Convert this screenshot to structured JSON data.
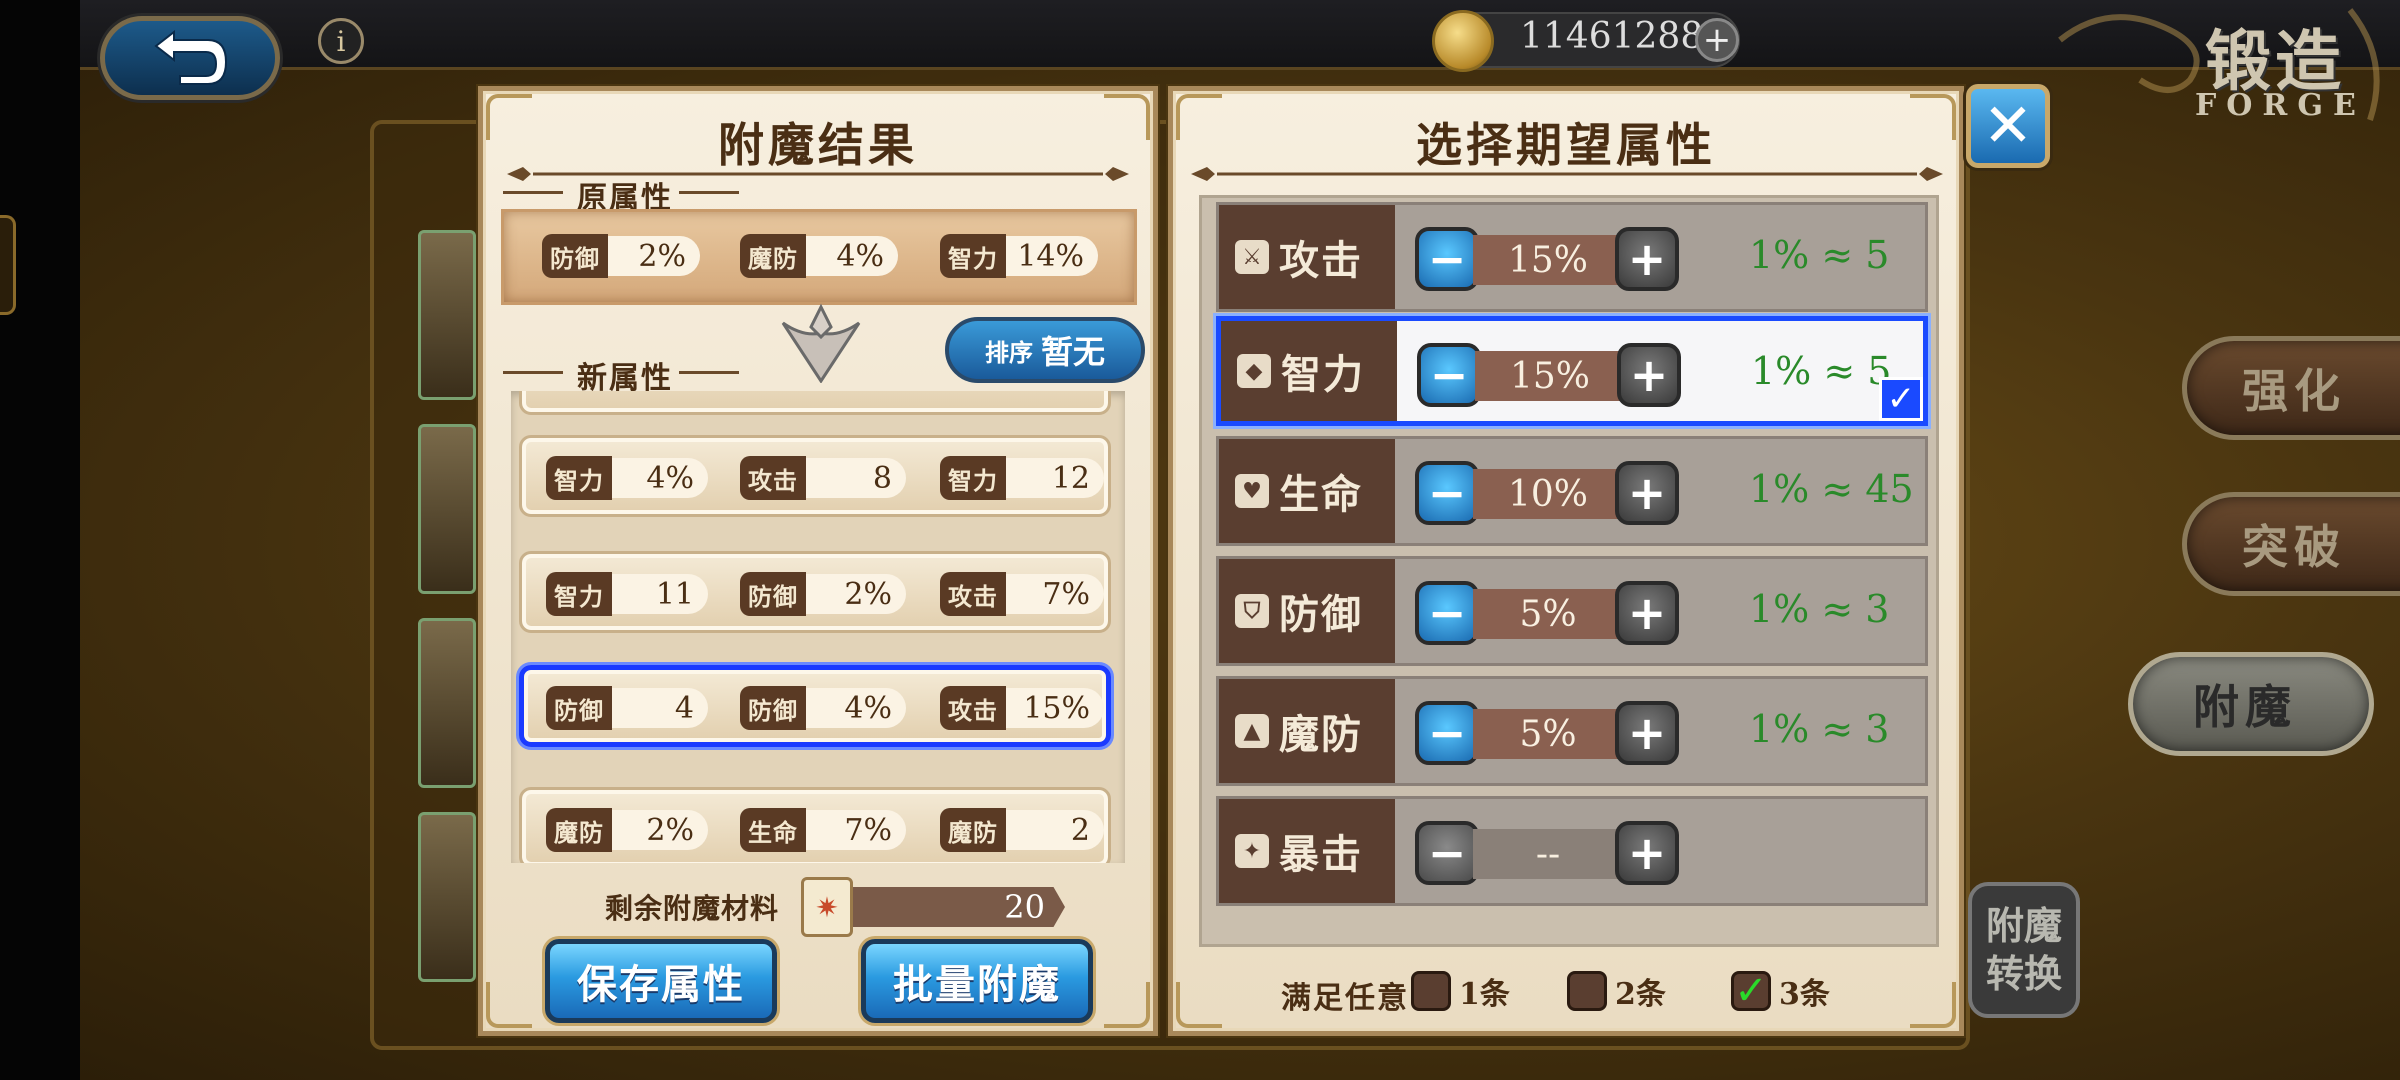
{
  "header": {
    "gold": "11461288",
    "gold_plus": "+",
    "info": "i",
    "forge_title": "锻造",
    "forge_subtitle": "FORGE"
  },
  "side_tabs": {
    "strengthen": "强化",
    "breakthrough": "突破",
    "enchant": "附魔",
    "convert": "附魔转换"
  },
  "left_panel": {
    "title": "附魔结果",
    "original_label": "原属性",
    "original_stats": [
      {
        "name": "防御",
        "value": "2%"
      },
      {
        "name": "魔防",
        "value": "4%"
      },
      {
        "name": "智力",
        "value": "14%"
      }
    ],
    "new_label": "新属性",
    "sort_label": "排序",
    "sort_value": "暂无",
    "results": [
      {
        "stats": [
          {
            "name": "智力",
            "value": "4%"
          },
          {
            "name": "攻击",
            "value": "8"
          },
          {
            "name": "智力",
            "value": "12"
          }
        ]
      },
      {
        "stats": [
          {
            "name": "智力",
            "value": "11"
          },
          {
            "name": "防御",
            "value": "2%"
          },
          {
            "name": "攻击",
            "value": "7%"
          }
        ]
      },
      {
        "stats": [
          {
            "name": "防御",
            "value": "4"
          },
          {
            "name": "防御",
            "value": "4%"
          },
          {
            "name": "攻击",
            "value": "15%"
          }
        ],
        "selected": true
      },
      {
        "stats": [
          {
            "name": "魔防",
            "value": "2%"
          },
          {
            "name": "生命",
            "value": "7%"
          },
          {
            "name": "魔防",
            "value": "2"
          }
        ]
      }
    ],
    "material_label": "剩余附魔材料",
    "material_count": "20",
    "save_button": "保存属性",
    "batch_button": "批量附魔"
  },
  "right_panel": {
    "title": "选择期望属性",
    "attributes": [
      {
        "name": "攻击",
        "icon": "sword-icon",
        "glyph": "⚔",
        "value": "15%",
        "ratio": "1% ≈ 5",
        "selected": false
      },
      {
        "name": "智力",
        "icon": "book-icon",
        "glyph": "◆",
        "value": "15%",
        "ratio": "1% ≈ 5",
        "selected": true
      },
      {
        "name": "生命",
        "icon": "heart-icon",
        "glyph": "♥",
        "value": "10%",
        "ratio": "1% ≈ 45",
        "selected": false
      },
      {
        "name": "防御",
        "icon": "shield-icon",
        "glyph": "⛉",
        "value": "5%",
        "ratio": "1% ≈ 3",
        "selected": false
      },
      {
        "name": "魔防",
        "icon": "magic-shield-icon",
        "glyph": "▲",
        "value": "5%",
        "ratio": "1% ≈ 3",
        "selected": false
      },
      {
        "name": "暴击",
        "icon": "crit-icon",
        "glyph": "✦",
        "value": "--",
        "ratio": "",
        "selected": false
      }
    ],
    "match_label": "满足任意",
    "match_options": [
      {
        "label": "1条",
        "checked": false
      },
      {
        "label": "2条",
        "checked": false
      },
      {
        "label": "3条",
        "checked": true
      }
    ]
  },
  "colors": {
    "accent_blue": "#1a4aff",
    "ratio_green": "#2a8a2a",
    "panel_bg": "#f7efdf",
    "brown_dark": "#5a3e30"
  }
}
